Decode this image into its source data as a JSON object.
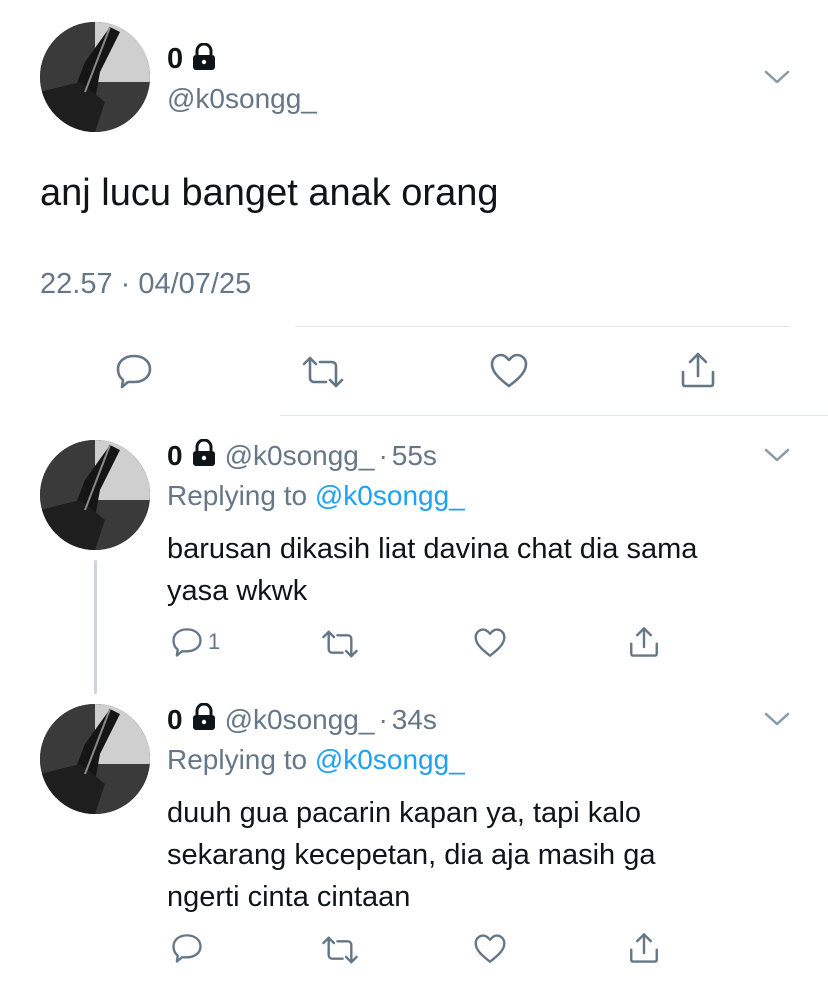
{
  "main_tweet": {
    "display_name": "0",
    "handle": "@k0songg_",
    "text": "anj lucu banget anak orang",
    "timestamp": "22.57 · 04/07/25"
  },
  "replies": [
    {
      "display_name": "0",
      "handle": "@k0songg_",
      "time": "55s",
      "replying_prefix": "Replying to",
      "replying_to": "@k0songg_",
      "text_line1": "barusan dikasih liat davina chat dia sama",
      "text_line2": "yasa wkwk",
      "reply_count": "1"
    },
    {
      "display_name": "0",
      "handle": "@k0songg_",
      "time": "34s",
      "replying_prefix": "Replying to",
      "replying_to": "@k0songg_",
      "text_line1": "duuh gua pacarin kapan ya, tapi kalo",
      "text_line2": "sekarang kecepetan, dia aja masih ga",
      "text_line3": "ngerti cinta cintaan"
    }
  ],
  "icons": [
    "lock-icon",
    "chevron-down-icon",
    "reply-icon",
    "retweet-icon",
    "like-icon",
    "share-icon"
  ],
  "colors": {
    "accent": "#1da1f2",
    "muted": "#657786",
    "text": "#0f1419",
    "divider": "#e1e8ed"
  }
}
